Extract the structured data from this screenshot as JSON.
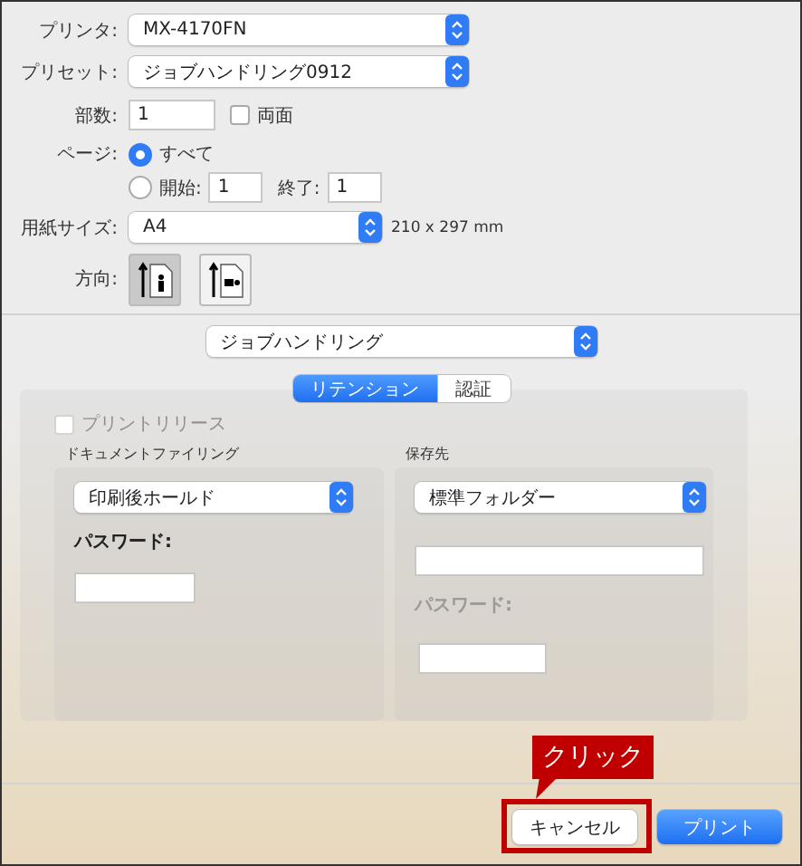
{
  "printer": {
    "label": "プリンタ:",
    "value": "MX-4170FN"
  },
  "preset": {
    "label": "プリセット:",
    "value": "ジョブハンドリング0912"
  },
  "copies": {
    "label": "部数:",
    "value": "1",
    "duplex": {
      "label": "両面",
      "checked": false
    }
  },
  "pages": {
    "label": "ページ:",
    "options": [
      {
        "label": "すべて",
        "selected": true
      },
      {
        "label": "開始:",
        "selected": false
      }
    ],
    "from": "1",
    "to_label": "終了:",
    "to": "1"
  },
  "paper": {
    "label": "用紙サイズ:",
    "value": "A4",
    "dimensions": "210 x 297 mm"
  },
  "orientation": {
    "label": "方向:",
    "options": [
      {
        "kind": "portrait",
        "selected": true
      },
      {
        "kind": "landscape",
        "selected": false
      }
    ]
  },
  "section": {
    "value": "ジョブハンドリング"
  },
  "tabs": [
    {
      "label": "リテンション",
      "selected": true
    },
    {
      "label": "認証",
      "selected": false
    }
  ],
  "print_release": {
    "label": "プリントリリース",
    "checked": false,
    "disabled": true
  },
  "document_filing": {
    "title": "ドキュメントファイリング",
    "mode": "印刷後ホールド",
    "password_label": "パスワード:",
    "password_disabled": false
  },
  "destination": {
    "title": "保存先",
    "folder": "標準フォルダー",
    "password_label": "パスワード:",
    "password_disabled": true
  },
  "buttons": [
    {
      "label": "キャンセル",
      "kind": "default"
    },
    {
      "label": "プリント",
      "kind": "primary"
    }
  ],
  "annotation": {
    "label": "クリック"
  }
}
